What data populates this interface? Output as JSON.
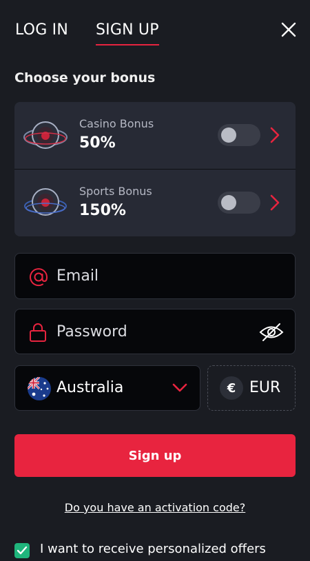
{
  "tabs": {
    "login": "LOG IN",
    "signup": "SIGN UP",
    "active": "signup"
  },
  "section_title": "Choose your bonus",
  "bonuses": [
    {
      "name": "Casino Bonus",
      "value": "50%",
      "enabled": false
    },
    {
      "name": "Sports Bonus",
      "value": "150%",
      "enabled": false
    }
  ],
  "form": {
    "email_placeholder": "Email",
    "password_placeholder": "Password",
    "country": "Australia",
    "currency_symbol": "€",
    "currency": "EUR"
  },
  "signup_button": "Sign up",
  "activation_link": "Do you have an activation code?",
  "offers_checkbox": {
    "label": "I want to receive personalized offers",
    "checked": true
  },
  "colors": {
    "accent": "#e8243f",
    "background": "#1a1c22",
    "panel": "#272a35",
    "checkbox": "#1fb57c"
  },
  "icons": [
    "close-icon",
    "bonus-chevron-icon",
    "at-icon",
    "lock-icon",
    "eye-slash-icon",
    "australia-flag-icon",
    "chevron-down-icon",
    "euro-icon",
    "check-icon"
  ]
}
